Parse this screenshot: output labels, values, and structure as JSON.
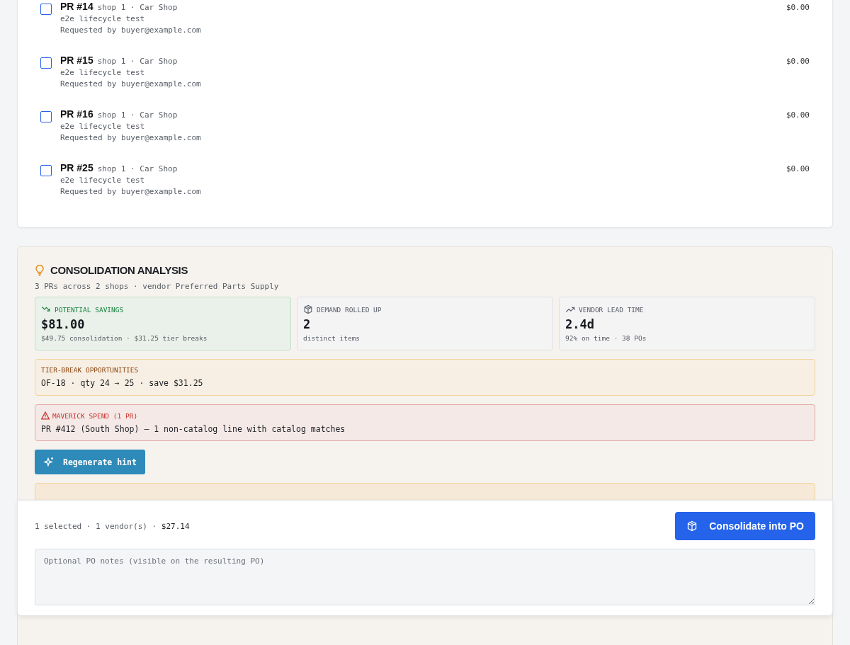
{
  "requests": [
    {
      "title": "PR #14",
      "shop": "shop 1 · Car Shop",
      "note": "e2e lifecycle test",
      "requester": "Requested by buyer@example.com",
      "amount": "$0.00",
      "checked": false
    },
    {
      "title": "PR #15",
      "shop": "shop 1 · Car Shop",
      "note": "e2e lifecycle test",
      "requester": "Requested by buyer@example.com",
      "amount": "$0.00",
      "checked": false
    },
    {
      "title": "PR #16",
      "shop": "shop 1 · Car Shop",
      "note": "e2e lifecycle test",
      "requester": "Requested by buyer@example.com",
      "amount": "$0.00",
      "checked": false
    },
    {
      "title": "PR #25",
      "shop": "shop 1 · Car Shop",
      "note": "e2e lifecycle test",
      "requester": "Requested by buyer@example.com",
      "amount": "$0.00",
      "checked": false
    }
  ],
  "analysis": {
    "title": "CONSOLIDATION ANALYSIS",
    "subtitle": "3 PRs across 2 shops · vendor Preferred Parts Supply",
    "stats": [
      {
        "kind": "savings",
        "label": "POTENTIAL SAVINGS",
        "value": "$81.00",
        "detail": "$49.75 consolidation · $31.25 tier breaks"
      },
      {
        "kind": "demand",
        "label": "DEMAND ROLLED UP",
        "value": "2",
        "detail": "distinct items"
      },
      {
        "kind": "lead",
        "label": "VENDOR LEAD TIME",
        "value": "2.4d",
        "detail": "92% on time · 38 POs"
      }
    ],
    "tier_breaks": {
      "label": "TIER-BREAK OPPORTUNITIES",
      "text": "OF-18 · qty 24 → 25 · save $31.25"
    },
    "maverick": {
      "label": "MAVERICK SPEND (1 PR)",
      "text": "PR #412 (South Shop) — 1 non-catalog line with catalog matches"
    },
    "regenerate_button": "Regenerate hint"
  },
  "footer": {
    "summary": "1 selected · 1 vendor(s) · ",
    "total": "$27.14",
    "consolidate_button": "Consolidate into PO",
    "notes": {
      "placeholder": "Optional PO notes (visible on the resulting PO)"
    }
  }
}
